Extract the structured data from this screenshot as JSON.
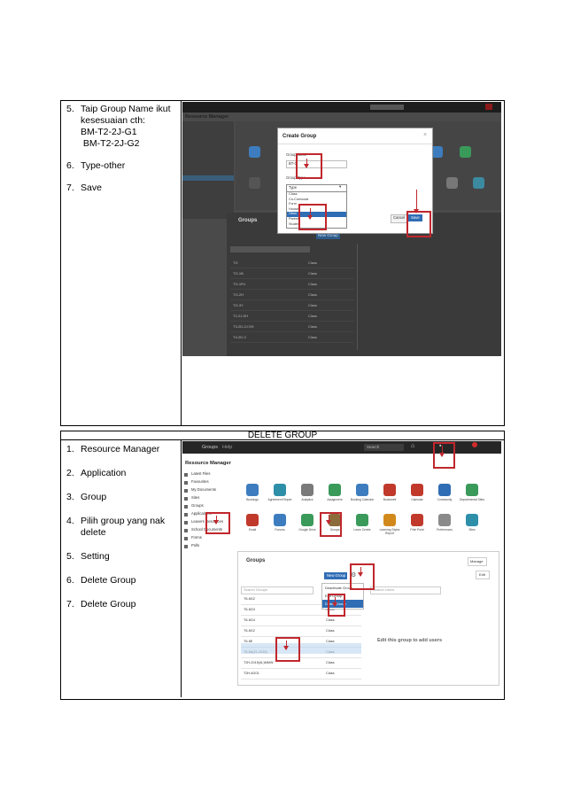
{
  "section_title": "DELETE GROUP",
  "create_steps": [
    {
      "n": "5.",
      "lines": [
        "Taip Group Name ikut",
        "kesesuaian cth:",
        "BM-T2-2J-G1",
        "BM-T2-2J-G2"
      ]
    },
    {
      "n": "6.",
      "lines": [
        "Type-other"
      ]
    },
    {
      "n": "7.",
      "lines": [
        "Save"
      ]
    }
  ],
  "delete_steps": [
    {
      "n": "1.",
      "lines": [
        "Resource Manager"
      ]
    },
    {
      "n": "2.",
      "lines": [
        "Application"
      ]
    },
    {
      "n": "3.",
      "lines": [
        "Group"
      ]
    },
    {
      "n": "4.",
      "lines": [
        "Pilih group yang nak",
        "delete"
      ]
    },
    {
      "n": "5.",
      "lines": [
        "Setting"
      ]
    },
    {
      "n": "6.",
      "lines": [
        "Delete Group"
      ]
    },
    {
      "n": "7.",
      "lines": [
        "Delete Group"
      ]
    }
  ],
  "shot1": {
    "dialog_title": "Create Group",
    "group_name_label": "Group name",
    "group_name_value": "BT-G",
    "type_label": "Group Type",
    "type_value": "Type",
    "type_options": [
      "Class",
      "Co-Curricular",
      "Form",
      "House",
      "Other",
      "Parent",
      "Student"
    ],
    "cancel": "Cancel",
    "save": "Save",
    "header": "Resource Manager",
    "groups_title": "Groups",
    "new_group": "New Group",
    "rows": [
      "TG",
      "TG-1B",
      "TG-1R1",
      "TG-2H",
      "TG-3Y",
      "T2-2J-SH",
      "T3-2D-2J-SH",
      "T4-2D-3"
    ],
    "row_type": "Class"
  },
  "shot2": {
    "topbar_title": "Groups",
    "topbar_help": "Help",
    "search": "Search",
    "header": "Resource Manager",
    "sidebar": [
      "Latest Files",
      "Favourites",
      "My Documents",
      "Sites",
      "Groups",
      "Applications",
      "Leavers Resources",
      "School Documents",
      "Forms",
      "Polls"
    ],
    "apps_row1": [
      "Bookings",
      "Agreement Report",
      "Analytics",
      "Assignment",
      "Booking Calendar",
      "Bookshelf",
      "Calendar",
      "Community",
      "Departmental Sites"
    ],
    "apps_row2": [
      "Email",
      "Forums",
      "Google Drive",
      "Groups",
      "Learn Centre",
      "Learning Styles Report",
      "Print Point",
      "Preferences",
      "Sites"
    ],
    "groups_title": "Groups",
    "manage": "Manage",
    "edit": "Edit",
    "new_group": "New Group",
    "search_groups": "Search Groups",
    "search_users": "Search Users",
    "menu": [
      "Deactivate Group",
      "Edit Group",
      "Delete Group"
    ],
    "rows": [
      "T6-6G2",
      "T6-6G3",
      "T6-6G4",
      "T6-6G2",
      "T6-6E",
      "T6-6A(21-2016)",
      "T2H-2015(4L)MMW",
      "T2H-6G01"
    ],
    "row_type": "Class",
    "empty_msg": "Edit this group to add users"
  }
}
